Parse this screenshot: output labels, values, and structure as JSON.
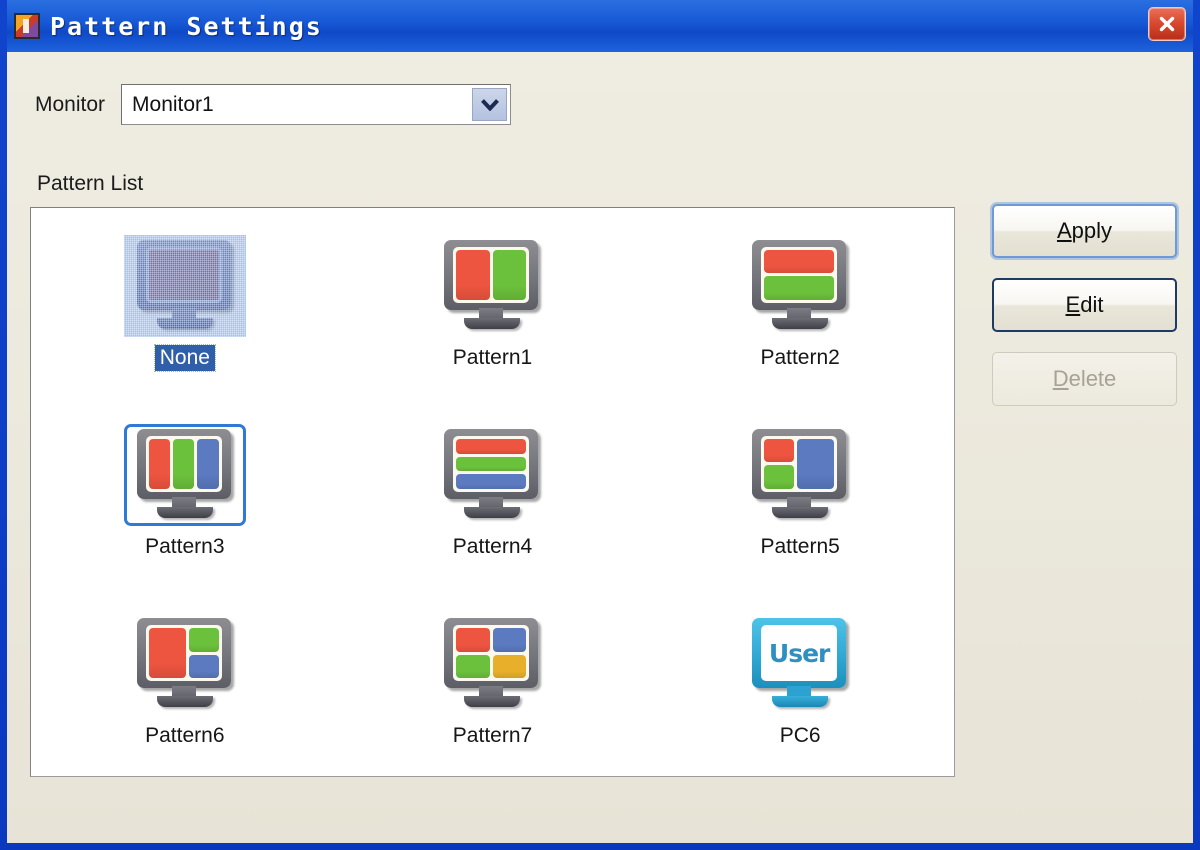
{
  "window": {
    "title": "Pattern Settings",
    "app_icon": "app-icon",
    "close_label": "close-icon",
    "frame_color": "#0f49c8",
    "client_bg": "#ebe8dc"
  },
  "monitor_field": {
    "label": "Monitor",
    "value": "Monitor1",
    "placeholder": "Monitor1",
    "arrow_icon": "chevron-down-icon"
  },
  "pattern_list": {
    "caption": "Pattern List",
    "items": [
      {
        "label": "None",
        "type": "plain",
        "selected": true,
        "focused": false,
        "panes": []
      },
      {
        "label": "Pattern1",
        "type": "pattern",
        "selected": false,
        "focused": false,
        "layout": "cols-2",
        "panes": [
          "#ee5540",
          "#6cc13c"
        ]
      },
      {
        "label": "Pattern2",
        "type": "pattern",
        "selected": false,
        "focused": false,
        "layout": "rows-2",
        "panes": [
          "#ee5540",
          "#6cc13c"
        ]
      },
      {
        "label": "Pattern3",
        "type": "pattern",
        "selected": false,
        "focused": true,
        "layout": "cols-3",
        "panes": [
          "#ee5540",
          "#6cc13c",
          "#5b7ac0"
        ]
      },
      {
        "label": "Pattern4",
        "type": "pattern",
        "selected": false,
        "focused": false,
        "layout": "rows-3",
        "panes": [
          "#ee5540",
          "#6cc13c",
          "#5b7ac0"
        ]
      },
      {
        "label": "Pattern5",
        "type": "pattern",
        "selected": false,
        "focused": false,
        "layout": "left-split",
        "panes": [
          "#ee5540",
          "#6cc13c",
          "#5b7ac0"
        ]
      },
      {
        "label": "Pattern6",
        "type": "pattern",
        "selected": false,
        "focused": false,
        "layout": "right-split",
        "panes": [
          "#ee5540",
          "#6cc13c",
          "#5b7ac0"
        ]
      },
      {
        "label": "Pattern7",
        "type": "pattern",
        "selected": false,
        "focused": false,
        "layout": "quad",
        "panes": [
          "#ee5540",
          "#5b7ac0",
          "#6cc13c",
          "#e8b02a"
        ]
      },
      {
        "label": "PC6",
        "type": "user",
        "selected": false,
        "focused": false,
        "screen_text": "User",
        "panes": []
      }
    ]
  },
  "buttons": [
    {
      "label": "Apply",
      "accel": "A",
      "state": "default"
    },
    {
      "label": "Edit",
      "accel": "E",
      "state": "normal"
    },
    {
      "label": "Delete",
      "accel": "D",
      "state": "disabled"
    }
  ]
}
